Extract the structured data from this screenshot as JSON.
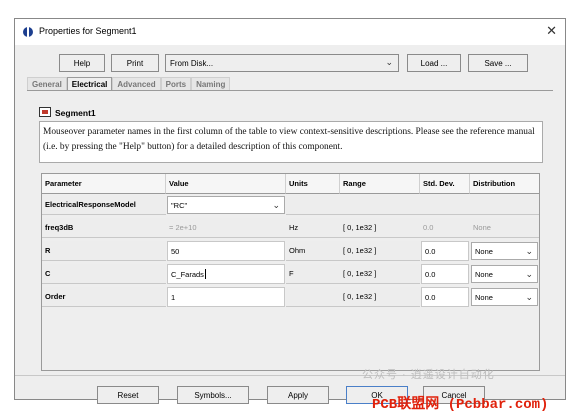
{
  "window": {
    "title": "Properties for Segment1",
    "close_label": "✕"
  },
  "toolbar": {
    "help_label": "Help",
    "print_label": "Print",
    "source_value": "From Disk...",
    "load_label": "Load ...",
    "save_label": "Save ..."
  },
  "tabs": [
    {
      "label": "General",
      "active": false
    },
    {
      "label": "Electrical",
      "active": true
    },
    {
      "label": "Advanced",
      "active": false
    },
    {
      "label": "Ports",
      "active": false
    },
    {
      "label": "Naming",
      "active": false
    }
  ],
  "component": {
    "name": "Segment1",
    "description": "Mouseover parameter names in the first column of the table to view context-sensitive descriptions. Please see the reference manual (i.e. by pressing the \"Help\" button) for a detailed description of this component."
  },
  "table": {
    "headers": [
      "Parameter",
      "Value",
      "Units",
      "Range",
      "Std. Dev.",
      "Distribution"
    ],
    "rows": [
      {
        "param": "ElectricalResponseModel",
        "value": "\"RC\"",
        "units": "",
        "range": "",
        "std": "",
        "dist": ""
      },
      {
        "param": "freq3dB",
        "value": "= 2e+10",
        "units": "Hz",
        "range": "[ 0, 1e32 ]",
        "std": "0.0",
        "dist": "None"
      },
      {
        "param": "R",
        "value": "50",
        "units": "Ohm",
        "range": "[ 0, 1e32 ]",
        "std": "0.0",
        "dist": "None"
      },
      {
        "param": "C",
        "value": "C_Farads",
        "units": "F",
        "range": "[ 0, 1e32 ]",
        "std": "0.0",
        "dist": "None"
      },
      {
        "param": "Order",
        "value": "1",
        "units": "",
        "range": "[ 0, 1e32 ]",
        "std": "0.0",
        "dist": "None"
      }
    ]
  },
  "footer": {
    "reset_label": "Reset",
    "symbols_label": "Symbols...",
    "apply_label": "Apply",
    "ok_label": "OK",
    "cancel_label": "Cancel"
  },
  "watermark": {
    "wechat": "公众号 · 逍遥设计自动化",
    "site": "PCB联盟网 (Pcbbar.com)"
  },
  "icons": {
    "app": "app-globe-icon",
    "component": "segment-component-icon",
    "dropdown": "chevron-down-icon"
  }
}
